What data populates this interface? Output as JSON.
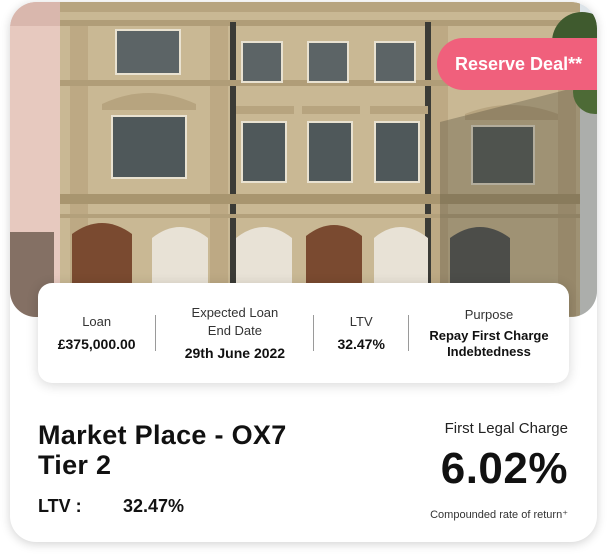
{
  "badge": {
    "label": "Reserve Deal**"
  },
  "stats": {
    "loan": {
      "label": "Loan",
      "value": "£375,000.00"
    },
    "end_date": {
      "label_line1": "Expected Loan",
      "label_line2": "End Date",
      "value": "29th June 2022"
    },
    "ltv": {
      "label": "LTV",
      "value": "32.47%"
    },
    "purpose": {
      "label": "Purpose",
      "value_line1": "Repay First Charge",
      "value_line2": "Indebtedness"
    }
  },
  "deal": {
    "title_line1": "Market Place - OX7",
    "title_line2": "Tier 2",
    "ltv_label": "LTV :",
    "ltv_value": "32.47%",
    "charge_type": "First Legal Charge",
    "rate": "6.02%",
    "rate_note": "Compounded rate of return⁺"
  },
  "colors": {
    "badge": "#f0607c",
    "stone": "#c9b894",
    "sky": "#dde4e9",
    "text": "#111111"
  },
  "image": {
    "subject": "stone-building-photo"
  }
}
